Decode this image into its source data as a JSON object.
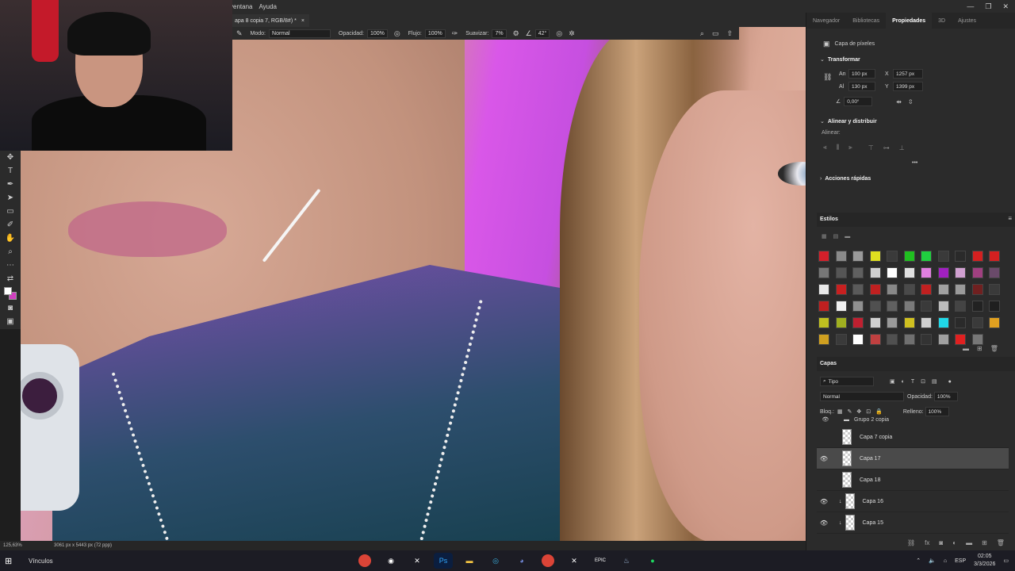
{
  "menubar": {
    "items": [
      "ventana",
      "Ayuda"
    ],
    "window_controls": [
      "—",
      "❐",
      "✕"
    ]
  },
  "document_tab": {
    "title": "apa 8 copia 7, RGB/8#) *",
    "close": "×"
  },
  "options_bar": {
    "mode_label": "Modo:",
    "mode_value": "Normal",
    "opacity_label": "Opacidad:",
    "opacity_value": "100%",
    "flow_label": "Flujo:",
    "flow_value": "100%",
    "smoothing_label": "Suavizar:",
    "smoothing_value": "7%",
    "angle_value": "42°"
  },
  "status_bar": {
    "zoom": "125,63%",
    "doc_info": "3061 px x 5443 px (72 ppp)"
  },
  "panel_tabs": [
    "Navegador",
    "Bibliotecas",
    "Propiedades",
    "3D",
    "Ajustes"
  ],
  "properties": {
    "layer_kind": "Capa de píxeles",
    "transform_title": "Transformar",
    "w_label": "An",
    "w_value": "100 px",
    "h_label": "Al",
    "h_value": "130 px",
    "x_label": "X",
    "x_value": "1257 px",
    "y_label": "Y",
    "y_value": "1399 px",
    "angle_value": "0,00°",
    "align_title": "Alinear y distribuir",
    "align_label": "Alinear:",
    "more": "•••",
    "quick_actions_title": "Acciones rápidas"
  },
  "styles": {
    "title": "Estilos",
    "swatches": [
      "#d4202a",
      "#8a8a8a",
      "#9a9a9a",
      "#e0e020",
      "#3a3a3a",
      "#20c020",
      "#20d040",
      "#3a3a3a",
      "#2a2a2a",
      "#d42020",
      "#d42020",
      "#777777",
      "#555555",
      "#606060",
      "#d0d0d0",
      "#ffffff",
      "#e0e0e0",
      "#e080e0",
      "#a020c0",
      "#d0a0d0",
      "#a04080",
      "#6a4a6a",
      "#e8e8e8",
      "#c82020",
      "#5a5a5a",
      "#c02020",
      "#888888",
      "#4a4a4a",
      "#c02020",
      "#a0a0a0",
      "#9a9a9a",
      "#702020",
      "#3a3a3a",
      "#c02020",
      "#f0f0f0",
      "#909090",
      "#505050",
      "#606060",
      "#7a7a7a",
      "#3a3a3a",
      "#bbbbbb",
      "#444444",
      "#222222",
      "#1f1f1f",
      "#c0c020",
      "#a0b020",
      "#c02030",
      "#d0d0d0",
      "#9a9a9a",
      "#d0c020",
      "#d0d0d0",
      "#20d8e8",
      "#2a2a2a",
      "#3a3a3a",
      "#e0a020",
      "#d0a020",
      "#3a3a3a",
      "#ffffff",
      "#c04040",
      "#505050",
      "#707070",
      "#333333",
      "#a0a0a0",
      "#e02020",
      "#777777"
    ]
  },
  "layers_panel": {
    "title": "Capas",
    "filter_value": "Tipo",
    "blend_value": "Normal",
    "opacity_label": "Opacidad:",
    "opacity_value": "100%",
    "lock_label": "Bloq.:",
    "fill_label": "Relleno:",
    "fill_value": "100%",
    "group_name": "Grupo 2 copia",
    "layers": [
      {
        "name": "Capa 7 copia",
        "visible": false,
        "selected": false,
        "clipped": false
      },
      {
        "name": "Capa 17",
        "visible": true,
        "selected": true,
        "clipped": false
      },
      {
        "name": "Capa 18",
        "visible": false,
        "selected": false,
        "clipped": false
      },
      {
        "name": "Capa 16",
        "visible": true,
        "selected": false,
        "clipped": true
      },
      {
        "name": "Capa 15",
        "visible": true,
        "selected": false,
        "clipped": true
      }
    ]
  },
  "taskbar": {
    "search_label": "Vínculos",
    "apps": [
      "Chrome",
      "OBS",
      "CapCut",
      "Ps",
      "Explorer",
      "Edge",
      "Discord",
      "Chrome",
      "CapCut",
      "Epic",
      "Steam",
      "Spotify"
    ],
    "language": "ESP",
    "time": "02:05",
    "date": "3/3/2026"
  }
}
